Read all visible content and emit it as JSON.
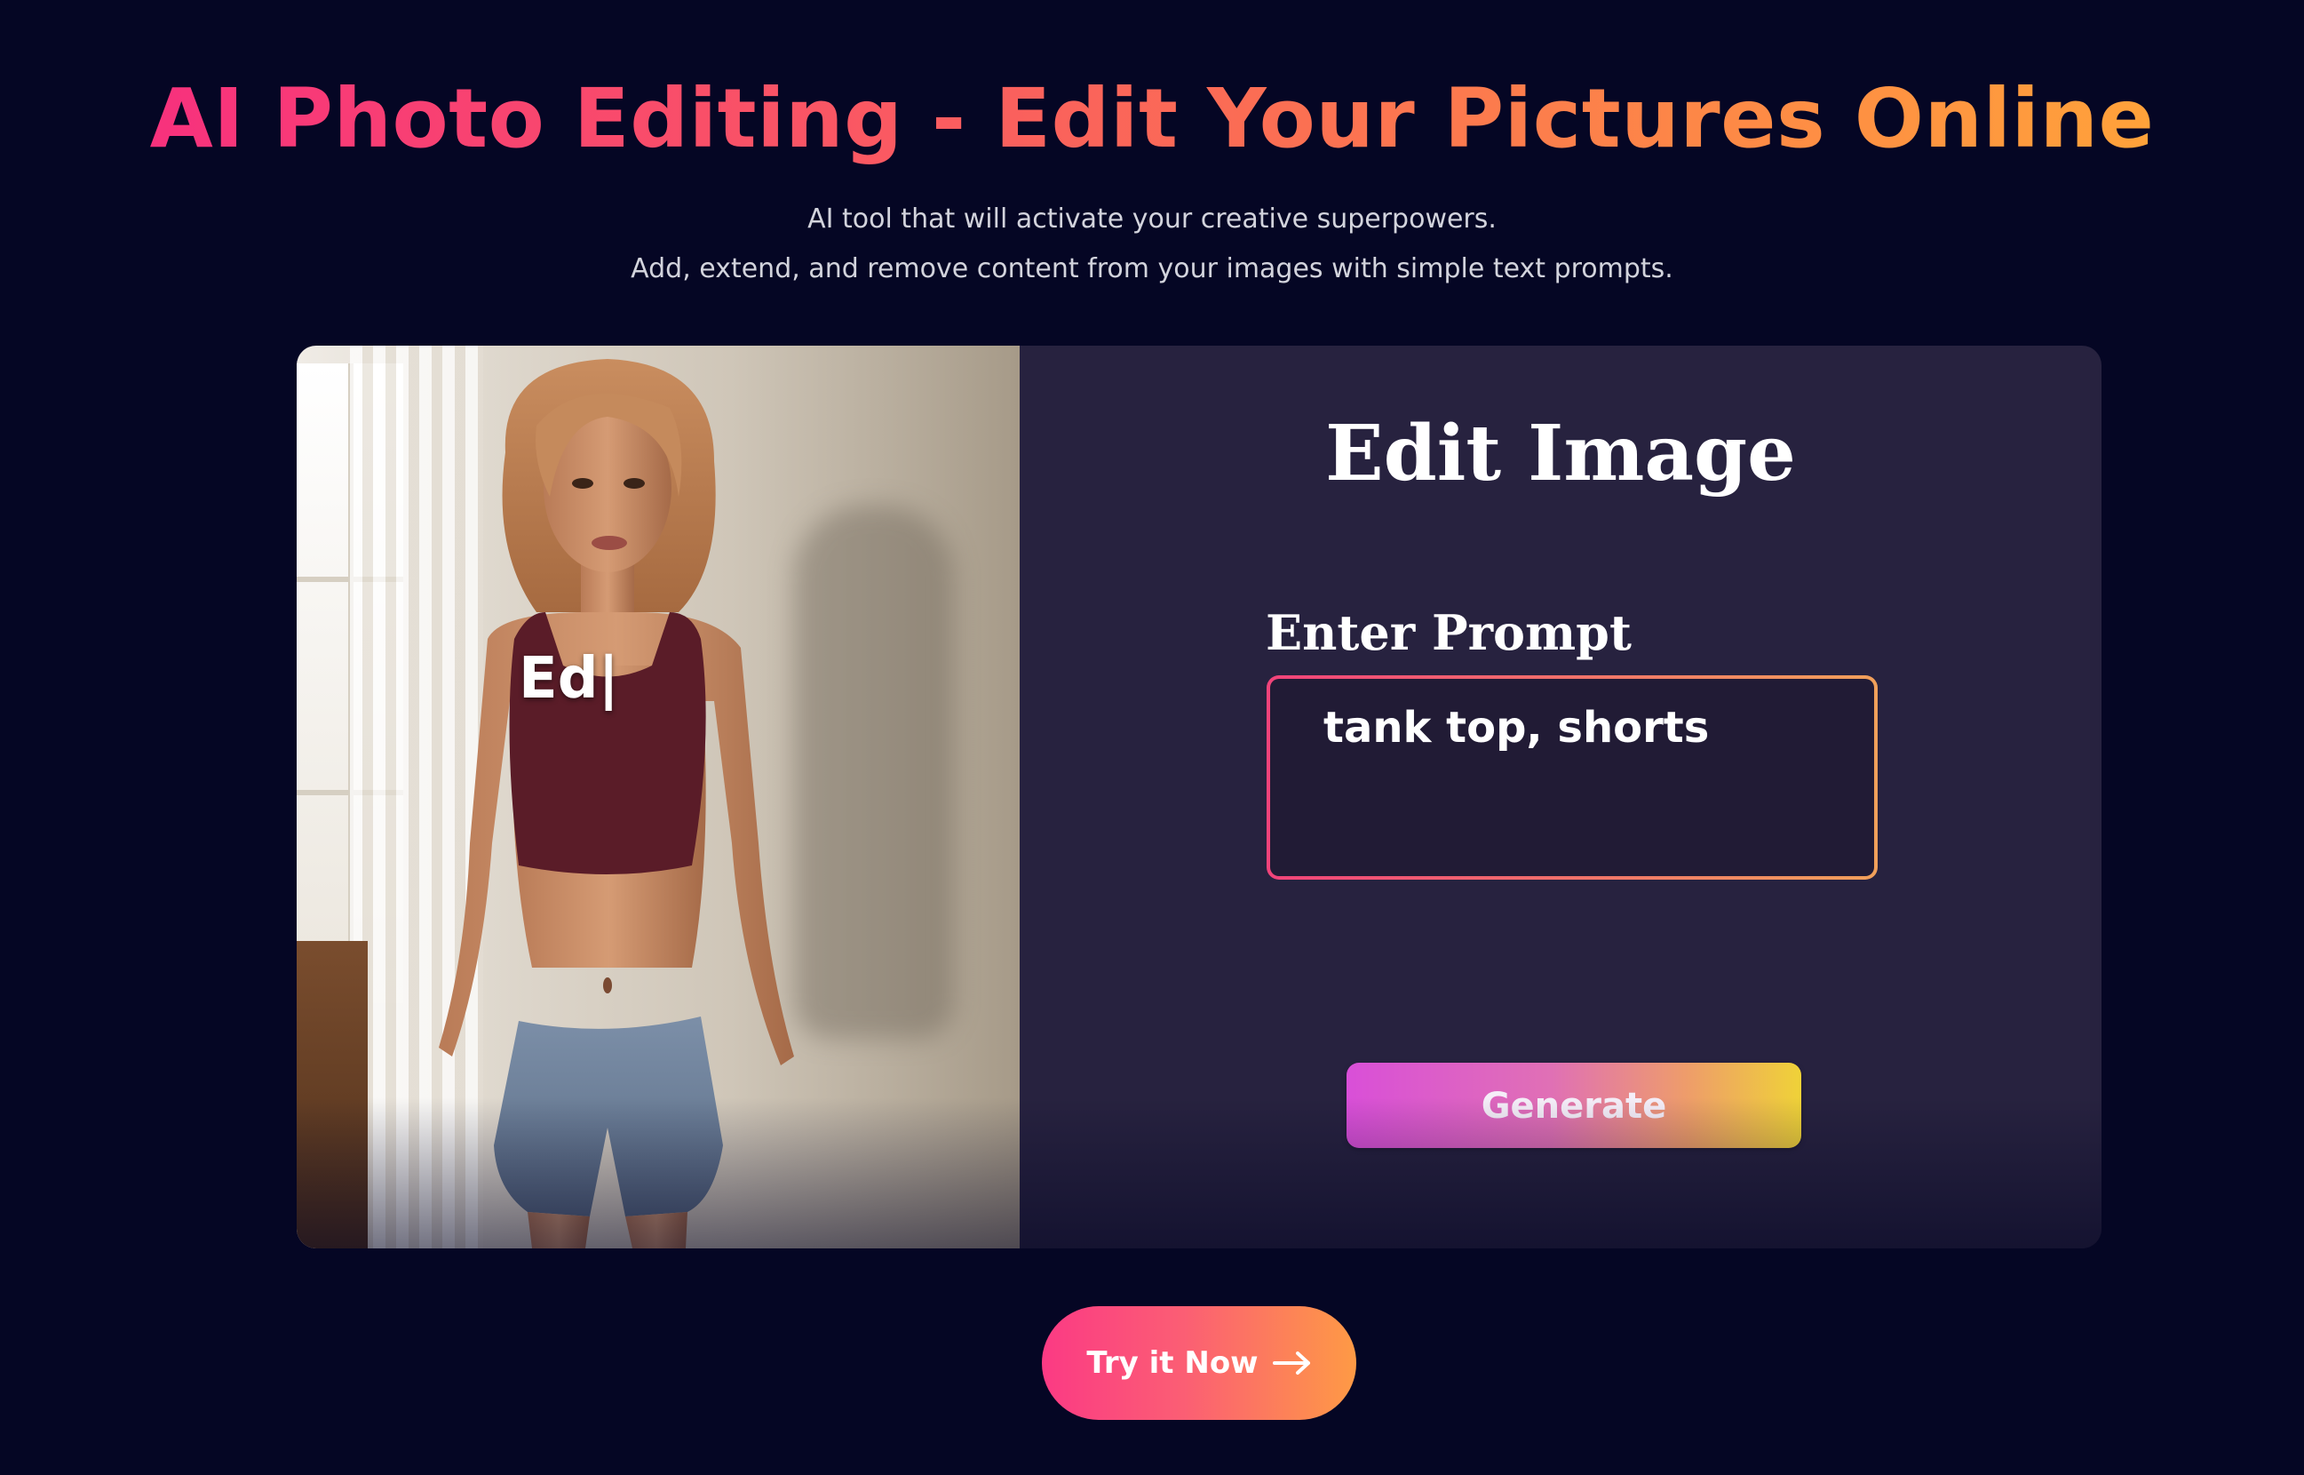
{
  "hero": {
    "title": "AI Photo Editing - Edit Your Pictures Online",
    "subtitle_line1": "AI tool that will activate your creative superpowers.",
    "subtitle_line2": "Add, extend, and remove content from your images with simple text prompts."
  },
  "demo": {
    "typing_text": "Ed|",
    "editor_title": "Edit Image",
    "prompt_label": "Enter Prompt",
    "prompt_value": "tank top, shorts",
    "generate_label": "Generate"
  },
  "cta": {
    "try_label": "Try it Now",
    "arrow_icon": "arrow-right-icon"
  },
  "colors": {
    "background": "#050624",
    "title_gradient_start": "#f7317d",
    "title_gradient_end": "#ffa23a",
    "editor_panel": "#27223f"
  }
}
